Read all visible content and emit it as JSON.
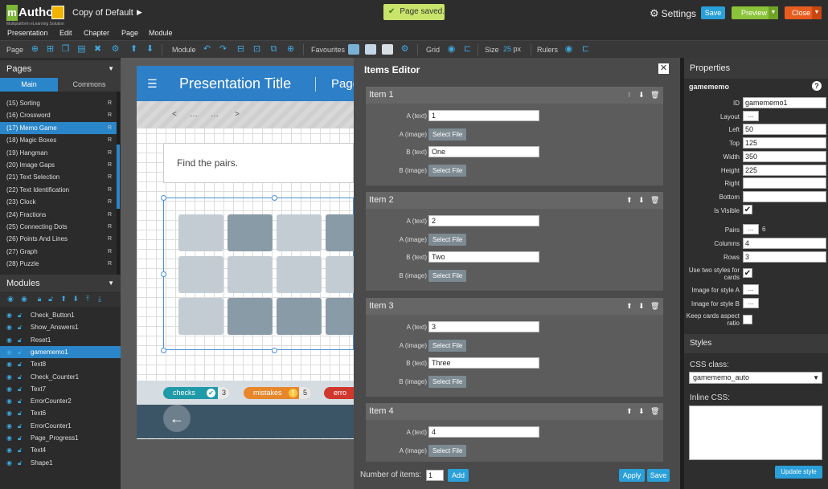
{
  "app": {
    "logo_mark": "m",
    "logo_text": "Author",
    "logo_sub": "Multiplatform eLearning Solution",
    "doc_title": "Copy of Default",
    "saved_msg": "Page saved.",
    "settings_label": "Settings",
    "save_label": "Save",
    "preview_label": "Preview",
    "close_label": "Close"
  },
  "menu": [
    "Presentation",
    "Edit",
    "Chapter",
    "Page",
    "Module"
  ],
  "toolbar": {
    "page_label": "Page",
    "module_label": "Module",
    "favourites_label": "Favourites",
    "grid_label": "Grid",
    "size_label": "Size",
    "size_value": "25",
    "size_unit": "px",
    "rulers_label": "Rulers"
  },
  "pages_panel": {
    "title": "Pages",
    "tabs": [
      "Main",
      "Commons"
    ],
    "items": [
      {
        "label": "(15) Sorting",
        "badge": "R"
      },
      {
        "label": "(16) Crossword",
        "badge": "R"
      },
      {
        "label": "(17) Memo Game",
        "badge": "R"
      },
      {
        "label": "(18) Magic Boxes",
        "badge": "R"
      },
      {
        "label": "(19) Hangman",
        "badge": "R"
      },
      {
        "label": "(20) Image Gaps",
        "badge": "R"
      },
      {
        "label": "(21) Text Selection",
        "badge": "R"
      },
      {
        "label": "(22) Text Identification",
        "badge": "R"
      },
      {
        "label": "(23) Clock",
        "badge": "R"
      },
      {
        "label": "(24) Fractions",
        "badge": "R"
      },
      {
        "label": "(25) Connecting Dots",
        "badge": "R"
      },
      {
        "label": "(26) Points And Lines",
        "badge": "R"
      },
      {
        "label": "(27) Graph",
        "badge": "R"
      },
      {
        "label": "(28) Puzzle",
        "badge": "R"
      }
    ]
  },
  "modules_panel": {
    "title": "Modules",
    "items": [
      "Check_Button1",
      "Show_Answers1",
      "Reset1",
      "gamememo1",
      "Text8",
      "Check_Counter1",
      "Text7",
      "ErrorCounter2",
      "Text6",
      "ErrorCounter1",
      "Page_Progress1",
      "Text4",
      "Shape1"
    ]
  },
  "canvas": {
    "pres_title": "Presentation Title",
    "page_label": "Page",
    "nav_prev": "<",
    "nav_dots1": "…",
    "nav_dots2": "…",
    "nav_next": ">",
    "instruction": "Find the pairs.",
    "checks_label": "checks",
    "checks_count": "3",
    "mistakes_label": "mistakes",
    "mistakes_count": "5",
    "errors_label": "erro"
  },
  "editor": {
    "title": "Items Editor",
    "labels": {
      "a_text": "A (text)",
      "a_image": "A (image)",
      "b_text": "B (text)",
      "b_image": "B (image)"
    },
    "select_file": "Select File",
    "items": [
      {
        "name": "Item 1",
        "a_text": "1",
        "b_text": "One"
      },
      {
        "name": "Item 2",
        "a_text": "2",
        "b_text": "Two"
      },
      {
        "name": "Item 3",
        "a_text": "3",
        "b_text": "Three"
      },
      {
        "name": "Item 4",
        "a_text": "4",
        "b_text": ""
      }
    ],
    "number_label": "Number of items:",
    "number_value": "1",
    "add_label": "Add",
    "apply_label": "Apply",
    "save_label": "Save"
  },
  "properties": {
    "title": "Properties",
    "module_name": "gamememo",
    "id_label": "ID",
    "id_value": "gamememo1",
    "layout_label": "Layout",
    "left_label": "Left",
    "left_value": "50",
    "top_label": "Top",
    "top_value": "125",
    "width_label": "Width",
    "width_value": "350",
    "height_label": "Height",
    "height_value": "225",
    "right_label": "Right",
    "right_value": "",
    "bottom_label": "Bottom",
    "bottom_value": "",
    "visible_label": "Is Visible",
    "pairs_label": "Pairs",
    "pairs_value": "6",
    "columns_label": "Columns",
    "columns_value": "4",
    "rows_label": "Rows",
    "rows_value": "3",
    "two_styles_label": "Use two styles for cards",
    "img_a_label": "Image for style A",
    "img_b_label": "Image for style B",
    "keep_aspect_label": "Keep cards aspect ratio",
    "dots": "...",
    "styles_title": "Styles",
    "css_class_label": "CSS class:",
    "css_class_value": "gamememo_auto",
    "inline_css_label": "Inline CSS:",
    "update_label": "Update style"
  },
  "colors": {
    "accent": "#2a9fd8",
    "preview": "#8bc33a",
    "close": "#e85c1f",
    "selected": "#2a86c9"
  }
}
